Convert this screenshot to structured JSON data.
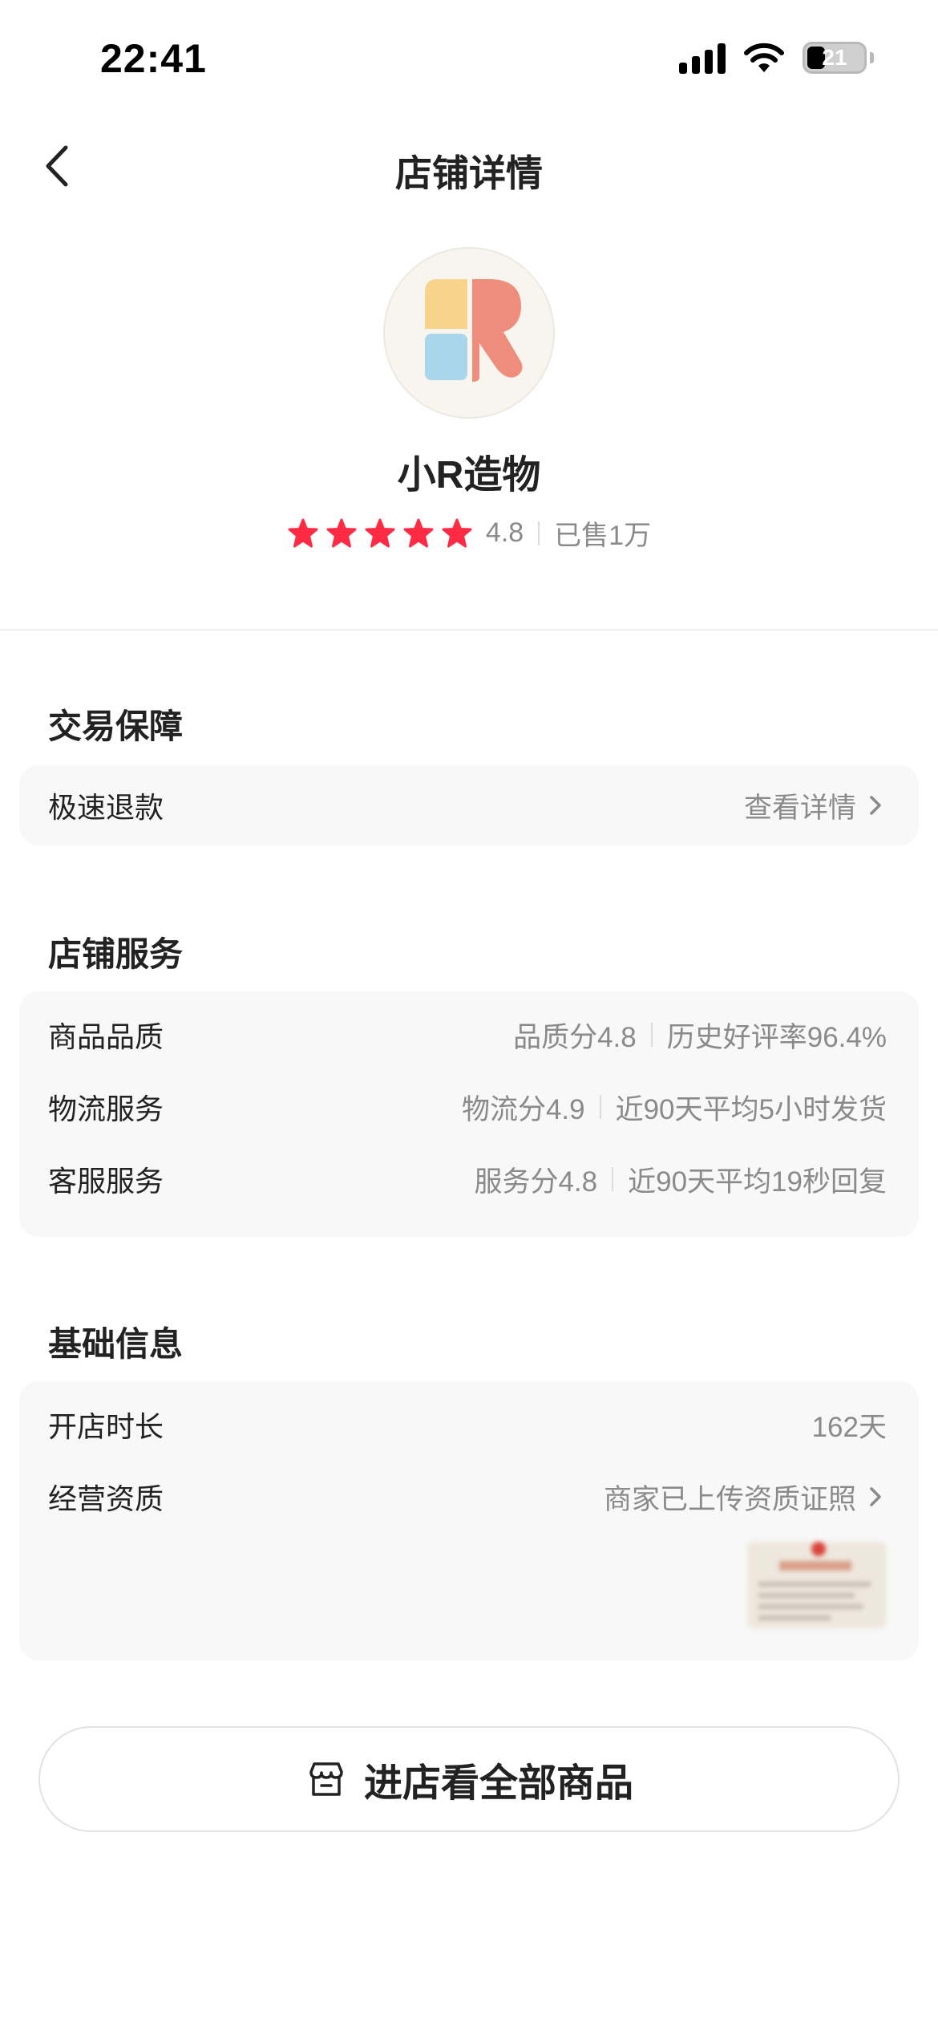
{
  "status_bar": {
    "time": "22:41",
    "battery": "21"
  },
  "nav": {
    "title": "店铺详情",
    "back_icon": "chevron-left-icon"
  },
  "shop": {
    "name": "小R造物",
    "rating": "4.8",
    "stars": 5,
    "sold": "已售1万",
    "star_color": "#ff2b45"
  },
  "sections": {
    "guarantee": {
      "title": "交易保障",
      "rows": [
        {
          "label": "极速退款",
          "value": "查看详情"
        }
      ]
    },
    "service": {
      "title": "店铺服务",
      "rows": [
        {
          "label": "商品品质",
          "value1": "品质分4.8",
          "value2": "历史好评率96.4%"
        },
        {
          "label": "物流服务",
          "value1": "物流分4.9",
          "value2": "近90天平均5小时发货"
        },
        {
          "label": "客服服务",
          "value1": "服务分4.8",
          "value2": "近90天平均19秒回复"
        }
      ]
    },
    "basic": {
      "title": "基础信息",
      "rows": [
        {
          "label": "开店时长",
          "value": "162天"
        },
        {
          "label": "经营资质",
          "value": "商家已上传资质证照"
        }
      ]
    }
  },
  "enter_button": {
    "label": "进店看全部商品",
    "icon": "store-icon"
  }
}
